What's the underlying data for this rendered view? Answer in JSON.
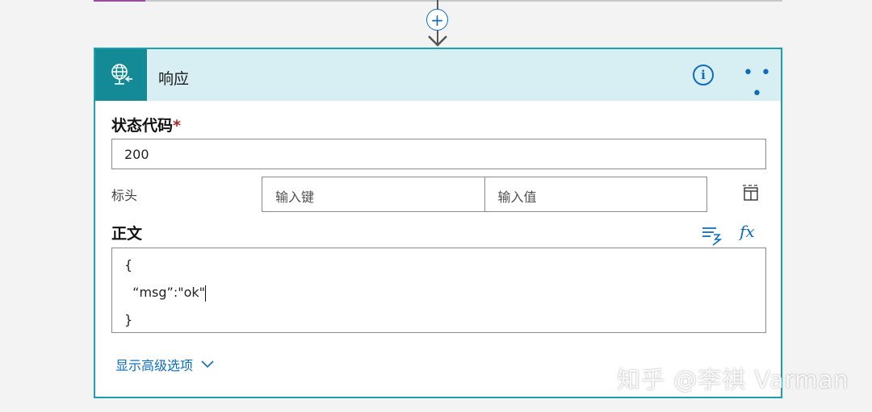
{
  "action": {
    "title": "响应"
  },
  "status_code": {
    "label": "状态代码",
    "required_mark": "*",
    "value": "200"
  },
  "headers": {
    "label": "标头",
    "key_placeholder": "输入键",
    "value_placeholder": "输入值"
  },
  "body": {
    "label": "正文",
    "lines": [
      "{",
      "  “msg”:\"ok\"",
      "}"
    ]
  },
  "advanced_options": {
    "label": "显示高级选项"
  },
  "watermark": "知乎 @李祺 Varman",
  "icons": {
    "add_step": "plus-circle-icon",
    "action": "globe-response-icon",
    "info": "info-icon",
    "more": "ellipsis-icon",
    "table_toggle": "switch-to-table-icon",
    "dynamic_content": "dynamic-content-icon",
    "expression": "expression-fx-icon",
    "chevron": "chevron-down-icon"
  },
  "colors": {
    "accent": "#0f6cbd",
    "header_bg": "#d7eef2",
    "icon_bg": "#138a95",
    "card_border": "#1d9fae"
  }
}
